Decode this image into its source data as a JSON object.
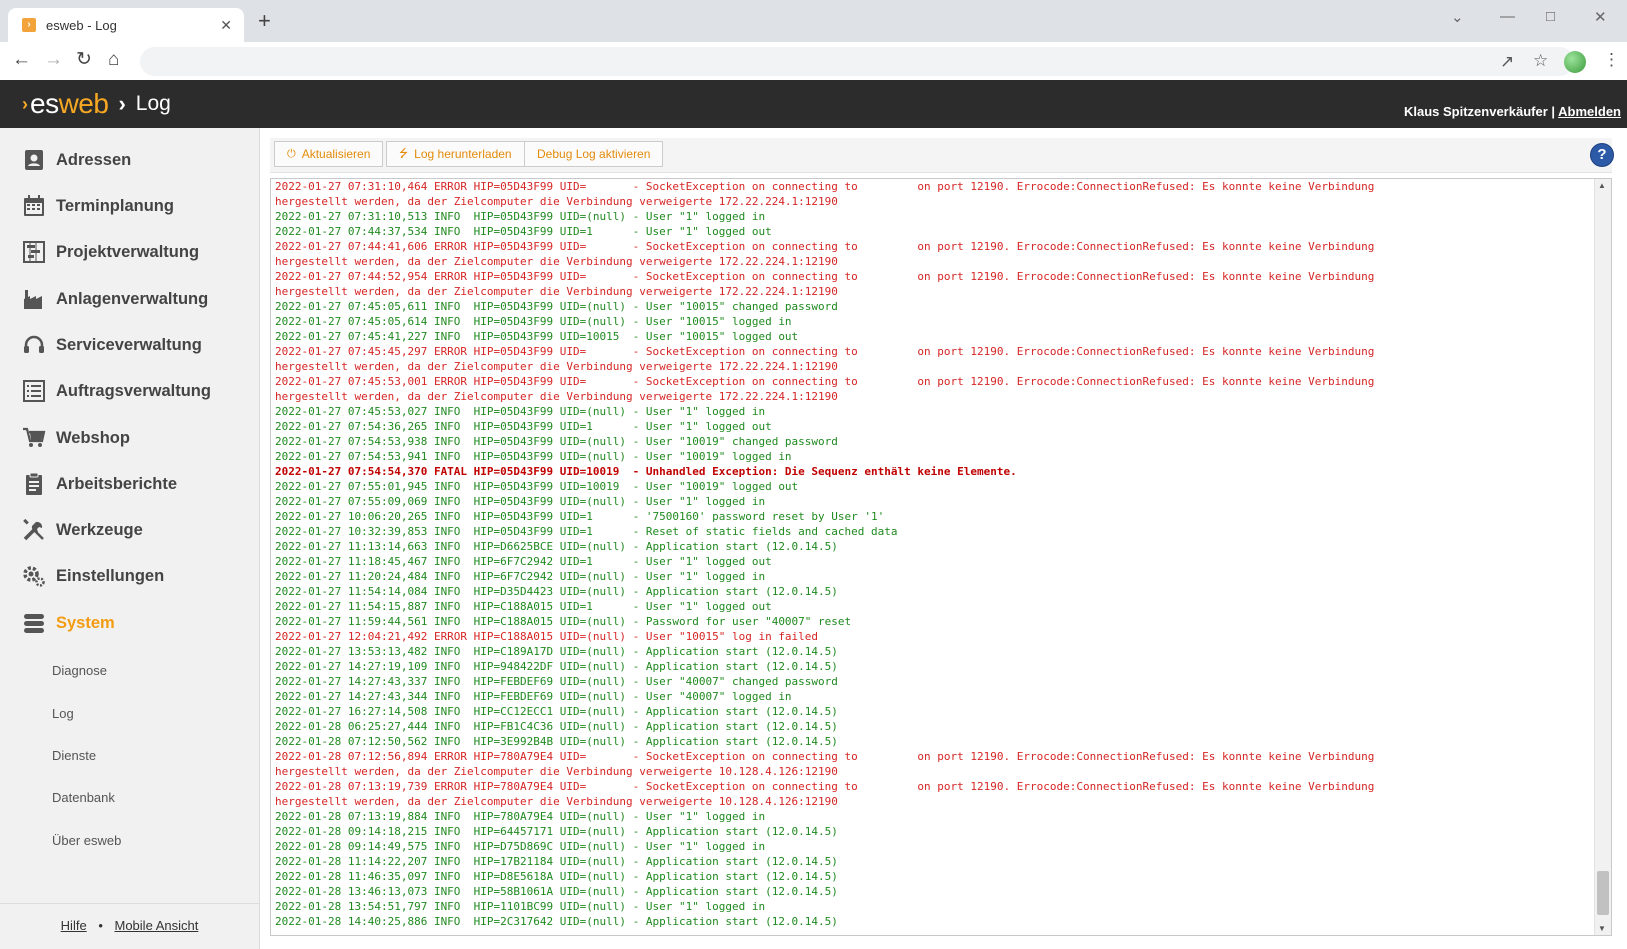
{
  "browser": {
    "tab_title": "esweb - Log",
    "new_tab": "+",
    "close_tab": "✕"
  },
  "app": {
    "brand_prefix": "es",
    "brand_suffix": "web",
    "separator": "›",
    "page_title": "Log",
    "user_name": "Klaus Spitzenverkäufer",
    "user_sep": " | ",
    "logout_label": "Abmelden"
  },
  "sidebar": {
    "items": [
      {
        "label": "Adressen",
        "icon": "address-book-icon"
      },
      {
        "label": "Terminplanung",
        "icon": "calendar-icon"
      },
      {
        "label": "Projektverwaltung",
        "icon": "gantt-icon"
      },
      {
        "label": "Anlagenverwaltung",
        "icon": "factory-icon"
      },
      {
        "label": "Serviceverwaltung",
        "icon": "headset-icon"
      },
      {
        "label": "Auftragsverwaltung",
        "icon": "list-icon"
      },
      {
        "label": "Webshop",
        "icon": "cart-icon"
      },
      {
        "label": "Arbeitsberichte",
        "icon": "clipboard-icon"
      },
      {
        "label": "Werkzeuge",
        "icon": "tools-icon"
      },
      {
        "label": "Einstellungen",
        "icon": "gears-icon"
      },
      {
        "label": "System",
        "icon": "database-icon",
        "active": true
      }
    ],
    "subitems": [
      "Diagnose",
      "Log",
      "Dienste",
      "Datenbank",
      "Über esweb"
    ],
    "footer": {
      "help": "Hilfe",
      "dot": "•",
      "mobile": "Mobile Ansicht"
    },
    "active_color": "#f39c12"
  },
  "toolbar": {
    "refresh": "Aktualisieren",
    "download": "Log herunterladen",
    "debug": "Debug Log aktivieren",
    "help": "?"
  },
  "colors": {
    "error": "#d62525",
    "info": "#1f8a1f",
    "fatal": "#c00000",
    "accent": "#f7a823"
  },
  "log_lines": [
    {
      "lvl": "error",
      "t": "2022-01-27 07:31:10,464 ERROR HIP=05D43F99 UID=       - SocketException on connecting to         on port 12190. Errocode:ConnectionRefused: Es konnte keine Verbindung"
    },
    {
      "lvl": "error",
      "t": "hergestellt werden, da der Zielcomputer die Verbindung verweigerte 172.22.224.1:12190"
    },
    {
      "lvl": "info",
      "t": "2022-01-27 07:31:10,513 INFO  HIP=05D43F99 UID=(null) - User \"1\" logged in"
    },
    {
      "lvl": "info",
      "t": "2022-01-27 07:44:37,534 INFO  HIP=05D43F99 UID=1      - User \"1\" logged out"
    },
    {
      "lvl": "error",
      "t": "2022-01-27 07:44:41,606 ERROR HIP=05D43F99 UID=       - SocketException on connecting to         on port 12190. Errocode:ConnectionRefused: Es konnte keine Verbindung"
    },
    {
      "lvl": "error",
      "t": "hergestellt werden, da der Zielcomputer die Verbindung verweigerte 172.22.224.1:12190"
    },
    {
      "lvl": "error",
      "t": "2022-01-27 07:44:52,954 ERROR HIP=05D43F99 UID=       - SocketException on connecting to         on port 12190. Errocode:ConnectionRefused: Es konnte keine Verbindung"
    },
    {
      "lvl": "error",
      "t": "hergestellt werden, da der Zielcomputer die Verbindung verweigerte 172.22.224.1:12190"
    },
    {
      "lvl": "info",
      "t": "2022-01-27 07:45:05,611 INFO  HIP=05D43F99 UID=(null) - User \"10015\" changed password"
    },
    {
      "lvl": "info",
      "t": "2022-01-27 07:45:05,614 INFO  HIP=05D43F99 UID=(null) - User \"10015\" logged in"
    },
    {
      "lvl": "info",
      "t": "2022-01-27 07:45:41,227 INFO  HIP=05D43F99 UID=10015  - User \"10015\" logged out"
    },
    {
      "lvl": "error",
      "t": "2022-01-27 07:45:45,297 ERROR HIP=05D43F99 UID=       - SocketException on connecting to         on port 12190. Errocode:ConnectionRefused: Es konnte keine Verbindung"
    },
    {
      "lvl": "error",
      "t": "hergestellt werden, da der Zielcomputer die Verbindung verweigerte 172.22.224.1:12190"
    },
    {
      "lvl": "error",
      "t": "2022-01-27 07:45:53,001 ERROR HIP=05D43F99 UID=       - SocketException on connecting to         on port 12190. Errocode:ConnectionRefused: Es konnte keine Verbindung"
    },
    {
      "lvl": "error",
      "t": "hergestellt werden, da der Zielcomputer die Verbindung verweigerte 172.22.224.1:12190"
    },
    {
      "lvl": "info",
      "t": "2022-01-27 07:45:53,027 INFO  HIP=05D43F99 UID=(null) - User \"1\" logged in"
    },
    {
      "lvl": "info",
      "t": "2022-01-27 07:54:36,265 INFO  HIP=05D43F99 UID=1      - User \"1\" logged out"
    },
    {
      "lvl": "info",
      "t": "2022-01-27 07:54:53,938 INFO  HIP=05D43F99 UID=(null) - User \"10019\" changed password"
    },
    {
      "lvl": "info",
      "t": "2022-01-27 07:54:53,941 INFO  HIP=05D43F99 UID=(null) - User \"10019\" logged in"
    },
    {
      "lvl": "fatal",
      "t": "2022-01-27 07:54:54,370 FATAL HIP=05D43F99 UID=10019  - Unhandled Exception: Die Sequenz enthält keine Elemente."
    },
    {
      "lvl": "info",
      "t": "2022-01-27 07:55:01,945 INFO  HIP=05D43F99 UID=10019  - User \"10019\" logged out"
    },
    {
      "lvl": "info",
      "t": "2022-01-27 07:55:09,069 INFO  HIP=05D43F99 UID=(null) - User \"1\" logged in"
    },
    {
      "lvl": "info",
      "t": "2022-01-27 10:06:20,265 INFO  HIP=05D43F99 UID=1      - '7500160' password reset by User '1'"
    },
    {
      "lvl": "info",
      "t": "2022-01-27 10:32:39,853 INFO  HIP=05D43F99 UID=1      - Reset of static fields and cached data"
    },
    {
      "lvl": "info",
      "t": "2022-01-27 11:13:14,663 INFO  HIP=D6625BCE UID=(null) - Application start (12.0.14.5)"
    },
    {
      "lvl": "info",
      "t": "2022-01-27 11:18:45,467 INFO  HIP=6F7C2942 UID=1      - User \"1\" logged out"
    },
    {
      "lvl": "info",
      "t": "2022-01-27 11:20:24,484 INFO  HIP=6F7C2942 UID=(null) - User \"1\" logged in"
    },
    {
      "lvl": "info",
      "t": "2022-01-27 11:54:14,084 INFO  HIP=D35D4423 UID=(null) - Application start (12.0.14.5)"
    },
    {
      "lvl": "info",
      "t": "2022-01-27 11:54:15,887 INFO  HIP=C188A015 UID=1      - User \"1\" logged out"
    },
    {
      "lvl": "info",
      "t": "2022-01-27 11:59:44,561 INFO  HIP=C188A015 UID=(null) - Password for user \"40007\" reset"
    },
    {
      "lvl": "error",
      "t": "2022-01-27 12:04:21,492 ERROR HIP=C188A015 UID=(null) - User \"10015\" log in failed"
    },
    {
      "lvl": "info",
      "t": "2022-01-27 13:53:13,482 INFO  HIP=C189A17D UID=(null) - Application start (12.0.14.5)"
    },
    {
      "lvl": "info",
      "t": "2022-01-27 14:27:19,109 INFO  HIP=948422DF UID=(null) - Application start (12.0.14.5)"
    },
    {
      "lvl": "info",
      "t": "2022-01-27 14:27:43,337 INFO  HIP=FEBDEF69 UID=(null) - User \"40007\" changed password"
    },
    {
      "lvl": "info",
      "t": "2022-01-27 14:27:43,344 INFO  HIP=FEBDEF69 UID=(null) - User \"40007\" logged in"
    },
    {
      "lvl": "info",
      "t": "2022-01-27 16:27:14,508 INFO  HIP=CC12ECC1 UID=(null) - Application start (12.0.14.5)"
    },
    {
      "lvl": "info",
      "t": "2022-01-28 06:25:27,444 INFO  HIP=FB1C4C36 UID=(null) - Application start (12.0.14.5)"
    },
    {
      "lvl": "info",
      "t": "2022-01-28 07:12:50,562 INFO  HIP=3E992B4B UID=(null) - Application start (12.0.14.5)"
    },
    {
      "lvl": "error",
      "t": "2022-01-28 07:12:56,894 ERROR HIP=780A79E4 UID=       - SocketException on connecting to         on port 12190. Errocode:ConnectionRefused: Es konnte keine Verbindung"
    },
    {
      "lvl": "error",
      "t": "hergestellt werden, da der Zielcomputer die Verbindung verweigerte 10.128.4.126:12190"
    },
    {
      "lvl": "error",
      "t": "2022-01-28 07:13:19,739 ERROR HIP=780A79E4 UID=       - SocketException on connecting to         on port 12190. Errocode:ConnectionRefused: Es konnte keine Verbindung"
    },
    {
      "lvl": "error",
      "t": "hergestellt werden, da der Zielcomputer die Verbindung verweigerte 10.128.4.126:12190"
    },
    {
      "lvl": "info",
      "t": "2022-01-28 07:13:19,884 INFO  HIP=780A79E4 UID=(null) - User \"1\" logged in"
    },
    {
      "lvl": "info",
      "t": "2022-01-28 09:14:18,215 INFO  HIP=64457171 UID=(null) - Application start (12.0.14.5)"
    },
    {
      "lvl": "info",
      "t": "2022-01-28 09:14:49,575 INFO  HIP=D75D869C UID=(null) - User \"1\" logged in"
    },
    {
      "lvl": "info",
      "t": "2022-01-28 11:14:22,207 INFO  HIP=17B21184 UID=(null) - Application start (12.0.14.5)"
    },
    {
      "lvl": "info",
      "t": "2022-01-28 11:46:35,097 INFO  HIP=D8E5618A UID=(null) - Application start (12.0.14.5)"
    },
    {
      "lvl": "info",
      "t": "2022-01-28 13:46:13,073 INFO  HIP=58B1061A UID=(null) - Application start (12.0.14.5)"
    },
    {
      "lvl": "info",
      "t": "2022-01-28 13:54:51,797 INFO  HIP=1101BC99 UID=(null) - User \"1\" logged in"
    },
    {
      "lvl": "info",
      "t": "2022-01-28 14:40:25,886 INFO  HIP=2C317642 UID=(null) - Application start (12.0.14.5)"
    }
  ]
}
